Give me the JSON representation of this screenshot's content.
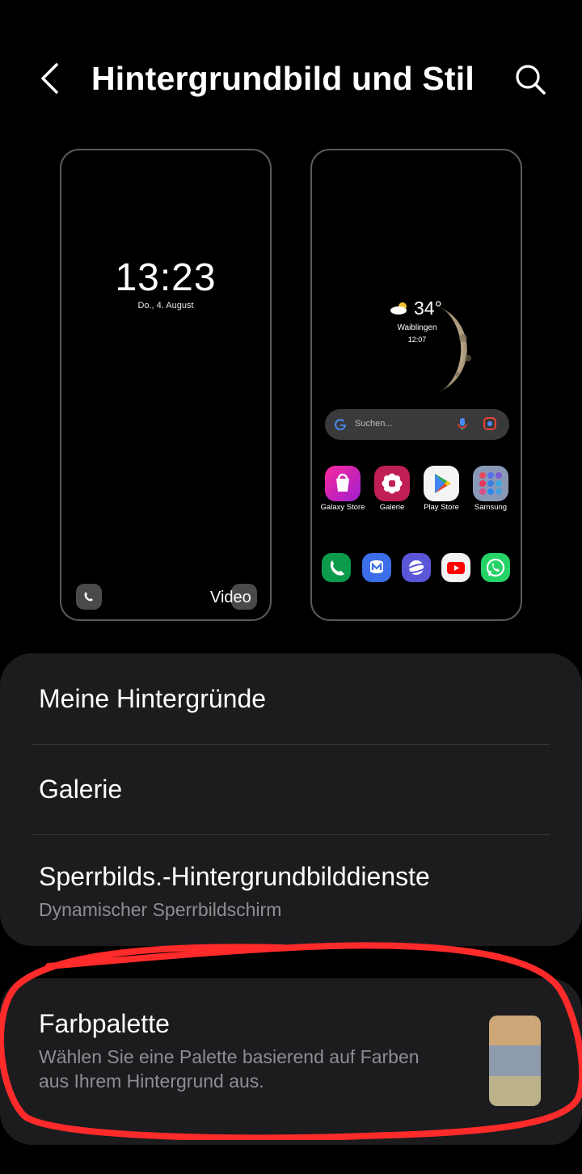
{
  "header": {
    "title": "Hintergrundbild und Stil"
  },
  "lock_preview": {
    "time": "13:23",
    "date": "Do., 4. August",
    "video_label": "Video"
  },
  "home_preview": {
    "weather_temp": "34°",
    "weather_location": "Waiblingen",
    "weather_time": "12:07",
    "search_placeholder": "Suchen...",
    "apps_row1": [
      {
        "label": "Galaxy Store",
        "icon": "galaxy-store-icon",
        "color": "#d6247e"
      },
      {
        "label": "Galerie",
        "icon": "gallery-icon",
        "color": "#c01f53"
      },
      {
        "label": "Play Store",
        "icon": "play-store-icon",
        "color": "#f4f4f4"
      },
      {
        "label": "Samsung",
        "icon": "samsung-folder-icon",
        "color": "#8a98b8"
      }
    ],
    "dock": [
      {
        "icon": "phone-icon",
        "color": "#0c9a4d"
      },
      {
        "icon": "messages-icon",
        "color": "#3b6ee8"
      },
      {
        "icon": "internet-icon",
        "color": "#5b56d8"
      },
      {
        "icon": "youtube-icon",
        "color": "#f2f2f2"
      },
      {
        "icon": "whatsapp-icon",
        "color": "#25d366"
      }
    ]
  },
  "menu": {
    "items": [
      {
        "title": "Meine Hintergründe"
      },
      {
        "title": "Galerie"
      },
      {
        "title": "Sperrbilds.-Hintergrundbilddienste",
        "subtitle": "Dynamischer Sperrbildschirm"
      }
    ],
    "palette": {
      "title": "Farbpalette",
      "subtitle_line1": "Wählen Sie eine Palette basierend auf Farben",
      "subtitle_line2": "aus Ihrem Hintergrund aus.",
      "swatch_colors": [
        "#cda777",
        "#8d9bac",
        "#bcb28a"
      ]
    }
  },
  "annotation_color": "#ff2a2a"
}
